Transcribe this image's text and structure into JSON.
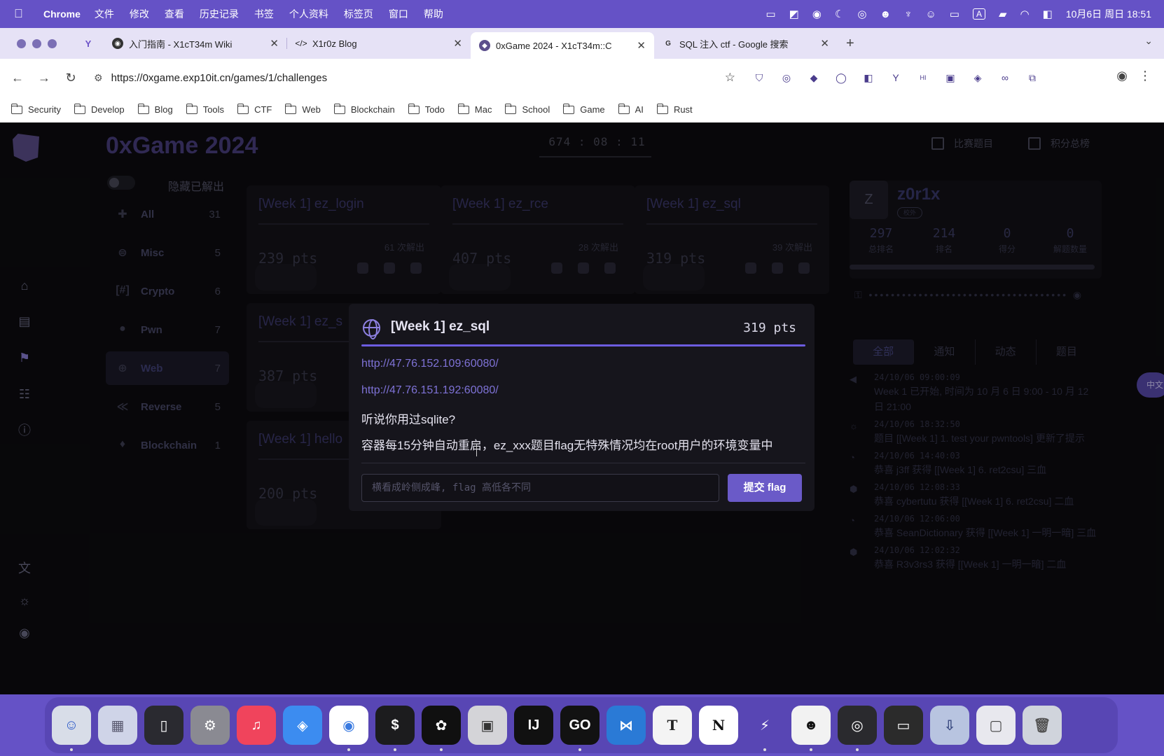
{
  "menubar": {
    "apple": "",
    "app_name": "Chrome",
    "items": [
      "文件",
      "修改",
      "查看",
      "历史记录",
      "书签",
      "个人资料",
      "标签页",
      "窗口",
      "帮助"
    ],
    "clock": "10月6日 周日 18:51",
    "status_icons": [
      "screen-share-icon",
      "stats-icon",
      "record-icon",
      "moon-icon",
      "vpn-icon",
      "cat-icon",
      "tree-icon",
      "smile-icon",
      "display-icon",
      "input-method-icon",
      "battery-icon",
      "wifi-icon",
      "control-center-icon"
    ],
    "input_method": "A"
  },
  "browser": {
    "tabs": [
      {
        "title": "入门指南 - X1cT34m Wiki",
        "icon": "wiki-icon"
      },
      {
        "title": "X1r0z Blog",
        "icon": "code-icon"
      },
      {
        "title": "0xGame 2024 - X1cT34m::C",
        "icon": "game-icon",
        "active": true
      },
      {
        "title": "SQL 注入 ctf - Google 搜索",
        "icon": "google-icon"
      }
    ],
    "url": "https://0xgame.exp10it.cn/games/1/challenges",
    "bookmarks": [
      "Security",
      "Develop",
      "Blog",
      "Tools",
      "CTF",
      "Web",
      "Blockchain",
      "Todo",
      "Mac",
      "School",
      "Game",
      "AI",
      "Rust"
    ]
  },
  "app": {
    "title": "0xGame 2024",
    "timer": "674 : 08 : 11",
    "nav": {
      "challenges": "比赛题目",
      "scoreboard": "积分总榜"
    },
    "hide_solved_label": "隐藏已解出",
    "categories": [
      {
        "name": "All",
        "count": "31",
        "icon": "puzzle-icon"
      },
      {
        "name": "Misc",
        "count": "5",
        "icon": "gamepad-icon"
      },
      {
        "name": "Crypto",
        "count": "6",
        "icon": "crypto-icon"
      },
      {
        "name": "Pwn",
        "count": "7",
        "icon": "bomb-icon"
      },
      {
        "name": "Web",
        "count": "7",
        "icon": "globe-icon",
        "active": true
      },
      {
        "name": "Reverse",
        "count": "5",
        "icon": "rewind-icon"
      },
      {
        "name": "Blockchain",
        "count": "1",
        "icon": "ethereum-icon"
      }
    ],
    "cards": [
      {
        "title": "[Week 1] ez_login",
        "pts": "239  pts",
        "solved": "61  次解出"
      },
      {
        "title": "[Week 1] ez_rce",
        "pts": "407  pts",
        "solved": "28  次解出"
      },
      {
        "title": "[Week 1] ez_sql",
        "pts": "319  pts",
        "solved": "39  次解出"
      },
      {
        "title": "[Week 1] ez_s",
        "pts": "387  pts",
        "solved": ""
      },
      {
        "title": "[Week 1] hello",
        "pts": "200  pts",
        "solved": ""
      }
    ],
    "profile": {
      "avatar_letter": "Z",
      "username": "z0r1x",
      "badge": "校外",
      "stats": [
        {
          "value": "297",
          "label": "总排名"
        },
        {
          "value": "214",
          "label": "排名"
        },
        {
          "value": "0",
          "label": "得分"
        },
        {
          "value": "0",
          "label": "解题数量"
        }
      ],
      "token_mask": "••••••••••••••••••••••••••••••••••••"
    },
    "feed_tabs": [
      "全部",
      "通知",
      "动态",
      "题目"
    ],
    "feed": [
      {
        "time": "24/10/06 09:00:09",
        "text": "Week 1 已开始, 时间为 10 月 6 日 9:00 - 10 月 12 日 21:00",
        "icon": "megaphone-icon"
      },
      {
        "time": "24/10/06 18:32:50",
        "text": "题目 [[Week 1] 1. test your pwntools] 更新了提示",
        "icon": "bulb-icon"
      },
      {
        "time": "24/10/06 14:40:03",
        "text": "恭喜 j3ff 获得 [[Week 1] 6. ret2csu] 三血",
        "icon": "clock-icon"
      },
      {
        "time": "24/10/06 12:08:33",
        "text": "恭喜 cybertutu 获得 [[Week 1] 6. ret2csu] 二血",
        "icon": "medal-icon"
      },
      {
        "time": "24/10/06 12:06:00",
        "text": "恭喜 SeanDictionary 获得 [[Week 1] 一明一暗] 三血",
        "icon": "clock-icon"
      },
      {
        "time": "24/10/06 12:02:32",
        "text": "恭喜 R3v3rs3 获得 [[Week 1] 一明一暗] 二血",
        "icon": "medal-icon"
      }
    ],
    "lang_button": "中文"
  },
  "modal": {
    "title": "[Week 1] ez_sql",
    "pts": "319  pts",
    "links": [
      "http://47.76.152.109:60080/",
      "http://47.76.151.192:60080/"
    ],
    "desc1": "听说你用过sqlite?",
    "desc2": "容器每15分钟自动重启，ez_xxx题目flag无特殊情况均在root用户的环境变量中",
    "input_placeholder": "横看成岭侧成峰, flag 高低各不同",
    "submit_label": "提交 flag"
  },
  "dock": [
    {
      "name": "finder",
      "glyph": "☺",
      "bg": "#d8dde8"
    },
    {
      "name": "launchpad",
      "glyph": "▦",
      "bg": "#cfd4e8"
    },
    {
      "name": "iphone-mirroring",
      "glyph": "▯",
      "bg": "#2a2a30"
    },
    {
      "name": "system-settings",
      "glyph": "⚙",
      "bg": "#8a8a92"
    },
    {
      "name": "music",
      "glyph": "♫",
      "bg": "#f0445c"
    },
    {
      "name": "safari",
      "glyph": "◈",
      "bg": "#3c8cf0"
    },
    {
      "name": "chrome",
      "glyph": "◉",
      "bg": "#ffffff"
    },
    {
      "name": "terminal",
      "glyph": "$",
      "bg": "#1c1c1e"
    },
    {
      "name": "chatgpt",
      "glyph": "✿",
      "bg": "#101010"
    },
    {
      "name": "monitor",
      "glyph": "▣",
      "bg": "#d4d4d8"
    },
    {
      "name": "intellij",
      "glyph": "IJ",
      "bg": "#111111"
    },
    {
      "name": "goland",
      "glyph": "GO",
      "bg": "#121212"
    },
    {
      "name": "vscode",
      "glyph": "⋈",
      "bg": "#2a7ad6"
    },
    {
      "name": "typora",
      "glyph": "T",
      "bg": "#f4f4f4"
    },
    {
      "name": "notion",
      "glyph": "N",
      "bg": "#ffffff"
    },
    {
      "name": "reeder",
      "glyph": "⚡",
      "bg": "#5846b4"
    },
    {
      "name": "qq",
      "glyph": "☻",
      "bg": "#f2f2f2"
    },
    {
      "name": "obs",
      "glyph": "◎",
      "bg": "#2a2a2e"
    },
    {
      "name": "console",
      "glyph": "▭",
      "bg": "#2b2b2b"
    },
    {
      "name": "downloads",
      "glyph": "⇩",
      "bg": "#b8c4e0"
    },
    {
      "name": "screenshot",
      "glyph": "▢",
      "bg": "#e8e8ee"
    },
    {
      "name": "trash",
      "glyph": "🗑",
      "bg": "#d0d4dc"
    }
  ]
}
